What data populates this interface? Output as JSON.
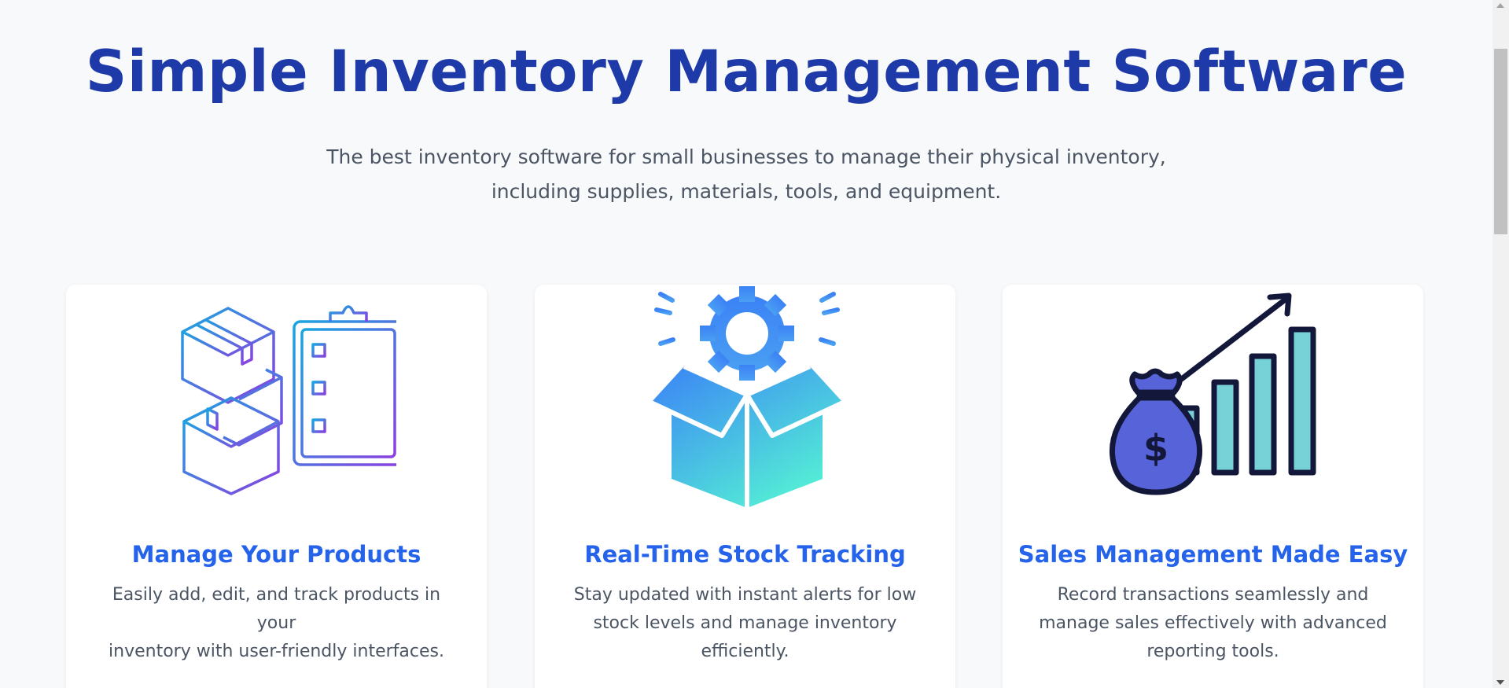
{
  "hero": {
    "title": "Simple Inventory Management Software",
    "subtitle_line1": "The best inventory software for small businesses to manage their physical inventory,",
    "subtitle_line2": "including supplies, materials, tools, and equipment."
  },
  "features": [
    {
      "icon": "boxes-clipboard-icon",
      "title": "Manage Your Products",
      "text_line1": "Easily add, edit, and track products in your",
      "text_line2": "inventory with user-friendly interfaces."
    },
    {
      "icon": "gear-box-icon",
      "title": "Real-Time Stock Tracking",
      "text_line1": "Stay updated with instant alerts for low",
      "text_line2": "stock levels and manage inventory",
      "text_line3": "efficiently."
    },
    {
      "icon": "money-bag-growth-chart-icon",
      "title": "Sales Management Made Easy",
      "text_line1": "Record transactions seamlessly and",
      "text_line2": "manage sales effectively with advanced",
      "text_line3": "reporting tools."
    }
  ],
  "colors": {
    "title": "#1e3aa8",
    "feature_title": "#2563eb",
    "body_text": "#4b5563",
    "background": "#f8f9fb"
  }
}
